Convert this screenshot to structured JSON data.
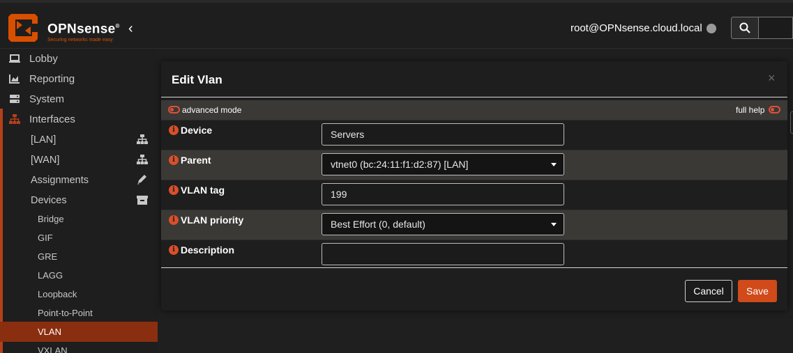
{
  "header": {
    "brand_name": "OPNsense",
    "brand_registered": "®",
    "brand_tagline": "Securing networks made easy",
    "collapse_icon": "‹",
    "user": "root@OPNsense.cloud.local",
    "status_color": "#9a9a9a",
    "accent_color": "#d94f00"
  },
  "sidebar": {
    "items": [
      {
        "label": "Lobby",
        "icon": "laptop-icon"
      },
      {
        "label": "Reporting",
        "icon": "area-chart-icon"
      },
      {
        "label": "System",
        "icon": "server-icon"
      },
      {
        "label": "Interfaces",
        "icon": "sitemap-icon"
      },
      {
        "label": "[LAN]",
        "icon": "sitemap-icon"
      },
      {
        "label": "[WAN]",
        "icon": "sitemap-icon"
      },
      {
        "label": "Assignments",
        "icon": "pencil-icon"
      },
      {
        "label": "Devices",
        "icon": "archive-icon"
      },
      {
        "label": "Bridge"
      },
      {
        "label": "GIF"
      },
      {
        "label": "GRE"
      },
      {
        "label": "LAGG"
      },
      {
        "label": "Loopback"
      },
      {
        "label": "Point-to-Point"
      },
      {
        "label": "VLAN",
        "active": true
      },
      {
        "label": "VXLAN"
      }
    ]
  },
  "modal": {
    "title": "Edit Vlan",
    "close": "×",
    "advanced_mode_label": "advanced mode",
    "full_help_label": "full help",
    "fields": [
      {
        "label": "Device",
        "value": "Servers",
        "type": "text"
      },
      {
        "label": "Parent",
        "value": "vtnet0 (bc:24:11:f1:d2:87) [LAN]",
        "type": "select"
      },
      {
        "label": "VLAN tag",
        "value": "199",
        "type": "text"
      },
      {
        "label": "VLAN priority",
        "value": "Best Effort (0, default)",
        "type": "select"
      },
      {
        "label": "Description",
        "value": "",
        "type": "text"
      }
    ],
    "info_glyph": "i",
    "cancel_label": "Cancel",
    "save_label": "Save"
  }
}
